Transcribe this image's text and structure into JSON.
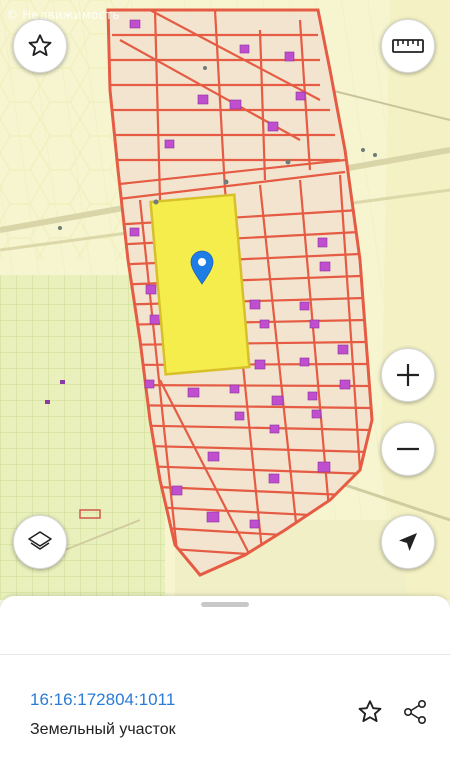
{
  "map": {
    "watermark": "© Недвижимость",
    "colors": {
      "background": "#f6f5d0",
      "parcel_fill": "#f3e4cf",
      "parcel_border": "#e55b43",
      "building": "#c04fd0",
      "selected_parcel": "#f4ed4b",
      "selected_border": "#d8c02a",
      "marker": "#1f7de6",
      "green_zone": "#eaf0bc"
    },
    "controls": {
      "favorite_icon": "star-outline-icon",
      "ruler_icon": "ruler-icon",
      "zoom_in_label": "+",
      "zoom_out_label": "−",
      "layers_icon": "layers-icon",
      "locate_icon": "navigation-arrow-icon"
    }
  },
  "sheet": {
    "cadastral_number": "16:16:172804:1011",
    "object_type": "Земельный участок",
    "favorite_icon": "star-outline-icon",
    "share_icon": "share-icon"
  }
}
